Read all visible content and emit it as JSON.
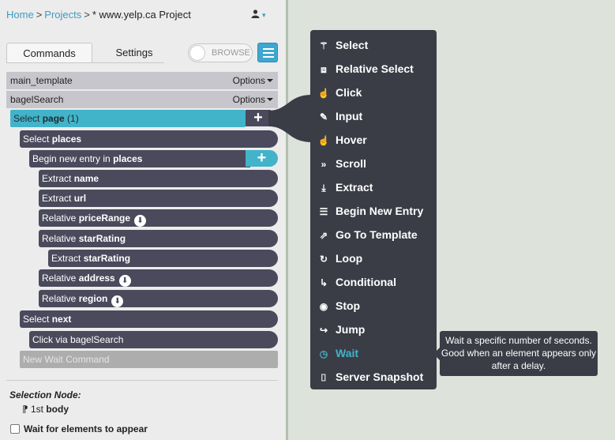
{
  "breadcrumb": {
    "home": "Home",
    "projects": "Projects",
    "current": "* www.yelp.ca Project"
  },
  "user": {
    "icon": "user-icon",
    "caret": "▾"
  },
  "tabs": {
    "commands": "Commands",
    "settings": "Settings"
  },
  "browse": {
    "label": "BROWSE",
    "on": false
  },
  "templates": [
    {
      "name": "main_template",
      "options": "Options"
    },
    {
      "name": "bagelSearch",
      "options": "Options"
    }
  ],
  "tree": {
    "n0": {
      "pre": "Select ",
      "bold": "page",
      "post": " (1)"
    },
    "n1": {
      "pre": "Select ",
      "bold": "places"
    },
    "n2": {
      "pre": "Begin new entry in ",
      "bold": "places"
    },
    "n3": {
      "pre": "Extract ",
      "bold": "name"
    },
    "n4": {
      "pre": "Extract ",
      "bold": "url"
    },
    "n5": {
      "pre": "Relative ",
      "bold": "priceRange"
    },
    "n6": {
      "pre": "Relative ",
      "bold": "starRating"
    },
    "n7": {
      "pre": "Extract ",
      "bold": "starRating"
    },
    "n8": {
      "pre": "Relative ",
      "bold": "address"
    },
    "n9": {
      "pre": "Relative ",
      "bold": "region"
    },
    "n10": {
      "pre": "Select ",
      "bold": "next"
    },
    "n11": {
      "pre": "Click via bagelSearch"
    },
    "n12": {
      "pre": "New Wait Command"
    }
  },
  "selection": {
    "label": "Selection Node:",
    "prefix": "1st ",
    "node": "body"
  },
  "wait_checkbox": {
    "label": "Wait for elements to appear",
    "checked": false
  },
  "menu": {
    "items": [
      {
        "label": "Select",
        "icon": "wand-icon"
      },
      {
        "label": "Relative Select",
        "icon": "relative-select-icon"
      },
      {
        "label": "Click",
        "icon": "pointer-hand-icon"
      },
      {
        "label": "Input",
        "icon": "pencil-icon"
      },
      {
        "label": "Hover",
        "icon": "hover-hand-icon"
      },
      {
        "label": "Scroll",
        "icon": "double-chevron-down-icon"
      },
      {
        "label": "Extract",
        "icon": "download-icon"
      },
      {
        "label": "Begin New Entry",
        "icon": "list-icon"
      },
      {
        "label": "Go To Template",
        "icon": "external-link-icon"
      },
      {
        "label": "Loop",
        "icon": "loop-icon"
      },
      {
        "label": "Conditional",
        "icon": "conditional-arrow-icon"
      },
      {
        "label": "Stop",
        "icon": "stop-icon"
      },
      {
        "label": "Jump",
        "icon": "jump-arrow-icon"
      },
      {
        "label": "Wait",
        "icon": "clock-icon",
        "highlighted": true
      },
      {
        "label": "Server Snapshot",
        "icon": "camera-icon"
      }
    ]
  },
  "tooltip": "Wait a specific number of seconds. Good when an element appears only after a delay.",
  "colors": {
    "accent": "#42b3c9",
    "node": "#4a4a5c",
    "menu": "#3a3d46",
    "link": "#3a9cc4"
  }
}
